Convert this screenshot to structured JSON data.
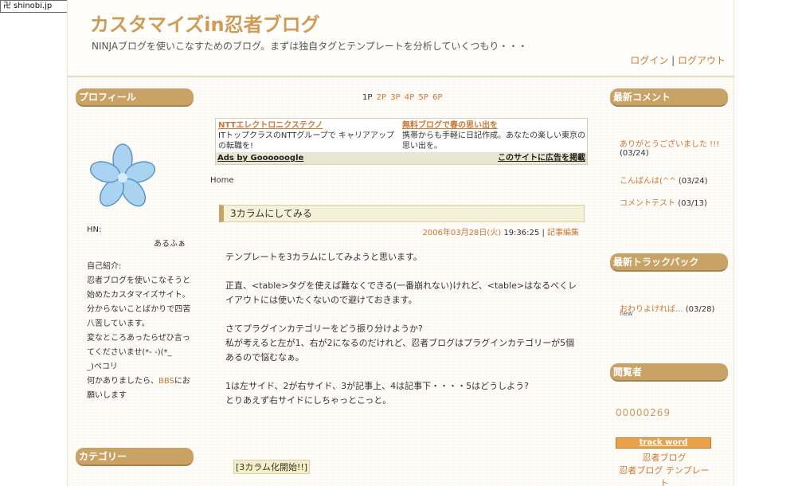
{
  "shinobi": {
    "label": "shinobi.jp"
  },
  "header": {
    "title": "カスタマイズin忍者ブログ",
    "description": "NINJAブログを使いこなすためのブログ。まずは独自タグとテンプレートを分析していくつもり・・・",
    "login": "ログイン",
    "separator": "|",
    "logout": "ログアウト"
  },
  "left": {
    "profile_head": "プロフィール",
    "hn_label": "HN:",
    "hn_value": "あるふぁ",
    "intro_label": "自己紹介:",
    "intro_lines": [
      "忍者ブログを使いこなそうと",
      "始めたカスタマイズサイト。",
      "分からないことばかりで四苦",
      "八苦しています。",
      "変なところあったらぜひ言っ",
      "てくださいませ(*- -)(*_",
      "_)ペコリ",
      "何かありましたら、"
    ],
    "bbs_link": "BBS",
    "bbs_suffix": "にお",
    "last_line": "願いします",
    "category_head": "カテゴリー"
  },
  "center": {
    "pager": {
      "current": "1P",
      "pages": [
        "2P",
        "3P",
        "4P",
        "5P",
        "6P"
      ]
    },
    "ad": {
      "left_title": "NTTエレクトロニクステクノ",
      "left_text": "ITトップクラスのNTTグループで キャリアアップの転職を!",
      "right_title": "無料ブログで春の思い出を",
      "right_text": "携帯からも手軽に日記作成。あなたの楽しい東京の思い出を。",
      "foot_left": "Ads by Goooooogle",
      "foot_right": "このサイトに広告を掲載"
    },
    "home": "Home",
    "entry_title": "3カラムにしてみる",
    "entry_date": "2006年03月28日(火)",
    "entry_time": "19:36:25",
    "entry_sep": "|",
    "entry_edit": "記事編集",
    "paragraphs": [
      "テンプレートを3カラムにしてみようと思います。",
      "正直、<table>タグを使えば難なくできる(一番崩れない)けれど、<table>はなるべくレイアウトには使いたくないので避けておきます。",
      "さてプラグインカテゴリーをどう振り分けようか?\n私が考えると左が1、右が2になるのだけれど、忍者ブログはプラグインカテゴリーが5個あるので悩むなぁ。",
      "1は左サイド、2が右サイド、3が記事上、4は記事下・・・・5はどうしよう?\nとりあえず右サイドにしちゃっとこっと。"
    ],
    "tag": "[3カラム化開始!!]"
  },
  "right": {
    "comments_head": "最新コメント",
    "comments": [
      {
        "text": "ありがとうございました !!!",
        "date": "(03/24)"
      },
      {
        "text": "こんばんは(^^",
        "date": "(03/24)"
      },
      {
        "text": "コメントテスト",
        "date": "(03/13)"
      }
    ],
    "trackback_head": "最新トラックバック",
    "trackback": {
      "text": "おわりよければ...",
      "date": "(03/28)",
      "badge": "new"
    },
    "visitors_head": "閲覧者",
    "counter": "00000269",
    "track_word": "track word",
    "track_items": [
      "忍者ブログ",
      "忍者ブログ テンプレー",
      "ト"
    ]
  }
}
